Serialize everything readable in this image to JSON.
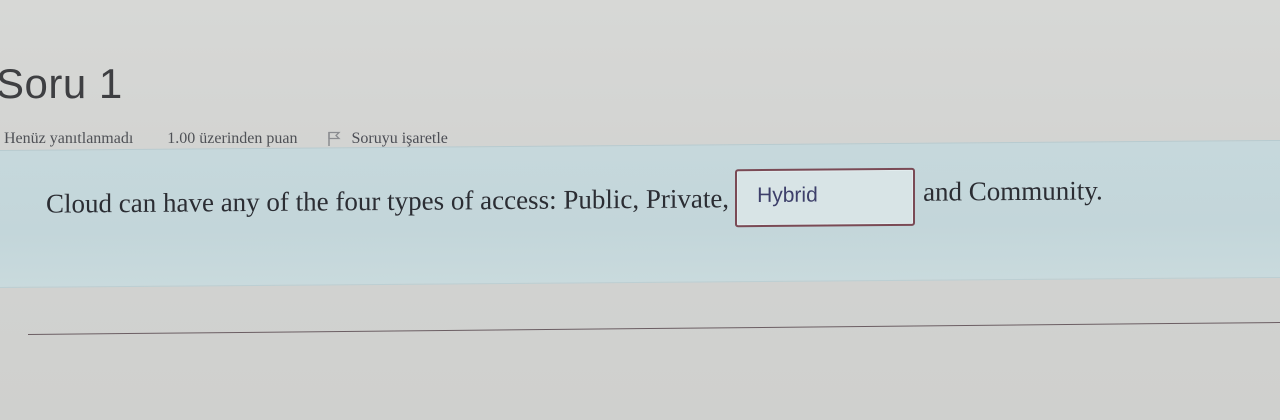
{
  "question": {
    "title": "Soru 1",
    "status": "Henüz yanıtlanmadı",
    "grade": "1.00 üzerinden puan",
    "flag_label": "Soruyu işaretle",
    "flag_icon": "flag-icon",
    "text_before": "Cloud can have any of the four types of access: Public, Private,",
    "answer_value": "Hybrid",
    "text_after": "and Community."
  },
  "colors": {
    "question_background": "#c6d8dc",
    "input_border": "#7a4a55",
    "title_text": "#3e3f42"
  }
}
